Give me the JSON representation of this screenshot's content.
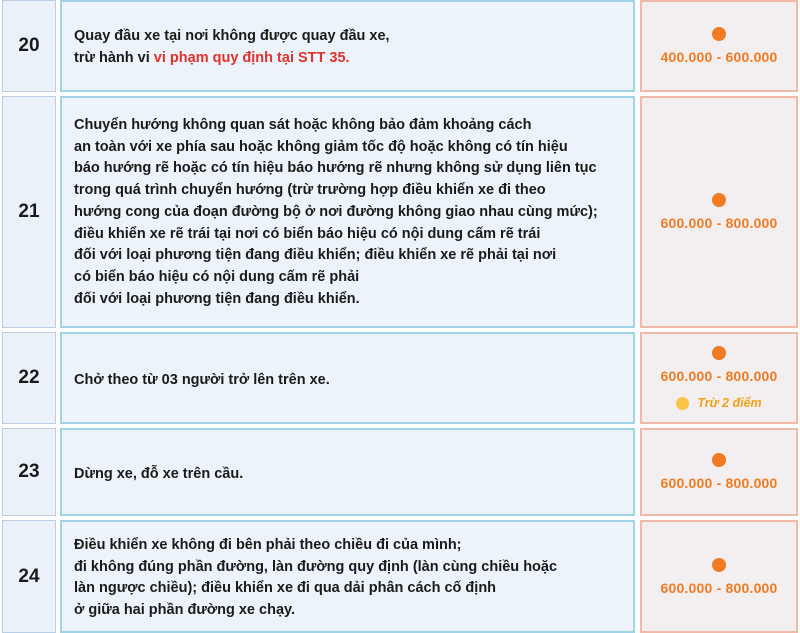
{
  "rows": [
    {
      "number": "20",
      "lines": [
        "Quay đầu xe tại nơi không được quay đầu xe,"
      ],
      "last_prefix": "trừ hành vi ",
      "last_highlight": "vi phạm quy định tại STT 35.",
      "fine": "400.000 - 600.000"
    },
    {
      "number": "21",
      "lines": [
        "Chuyển hướng không quan sát hoặc không bảo đảm khoảng cách",
        "an toàn với xe phía sau hoặc không giảm tốc độ hoặc không có tín hiệu",
        "báo hướng rẽ hoặc có tín hiệu báo hướng rẽ nhưng không sử dụng liên tục",
        "trong quá trình chuyển hướng (trừ trường hợp điều khiển xe đi theo",
        "hướng cong của đoạn đường bộ ở nơi đường không giao nhau cùng mức);",
        "điều khiển xe rẽ trái tại nơi có biển báo hiệu có nội dung cấm rẽ trái",
        "đối với loại phương tiện đang điều khiển; điều khiển xe rẽ phải tại nơi",
        "có biển báo hiệu có nội dung cấm rẽ phải",
        "đối với loại phương tiện đang điều khiển."
      ],
      "fine": "600.000 - 800.000"
    },
    {
      "number": "22",
      "lines": [
        "Chở theo từ 03 người trở lên trên xe."
      ],
      "fine": "600.000 - 800.000",
      "points": "Trừ 2 điểm"
    },
    {
      "number": "23",
      "lines": [
        "Dừng xe, đỗ xe trên cầu."
      ],
      "fine": "600.000 - 800.000"
    },
    {
      "number": "24",
      "lines": [
        "Điều khiển xe không đi bên phải theo chiều đi của mình;",
        "đi không đúng phần đường, làn đường quy định (làn cùng chiều hoặc",
        "làn ngược chiều); điều khiển xe đi qua dải phân cách cố định",
        "ở giữa hai phần đường xe chạy."
      ],
      "fine": "600.000 - 800.000"
    }
  ],
  "colors": {
    "fine_orange": "#f07b22",
    "points_yellow": "#f6c548",
    "highlight_red": "#e0312d",
    "cell_bg": "#eaf1f9"
  }
}
